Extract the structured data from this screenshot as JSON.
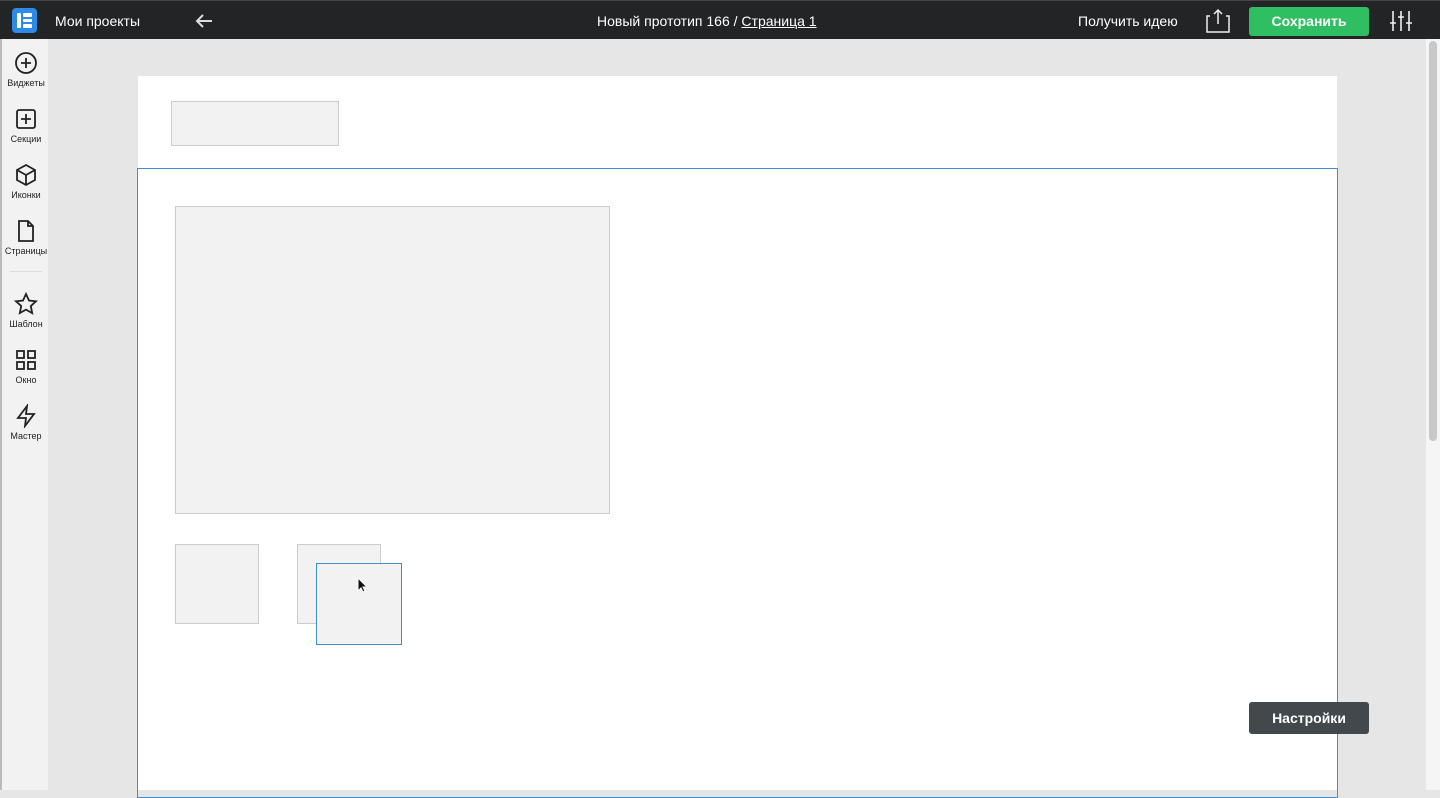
{
  "header": {
    "my_projects": "Мои проекты",
    "project_title": "Новый прототип 166 / ",
    "page_link": "Страница 1",
    "get_idea": "Получить идею",
    "save": "Сохранить"
  },
  "sidebar": {
    "items": [
      {
        "label": "Виджеты"
      },
      {
        "label": "Секции"
      },
      {
        "label": "Иконки"
      },
      {
        "label": "Страницы"
      },
      {
        "label": "Шаблон"
      },
      {
        "label": "Окно"
      },
      {
        "label": "Мастер"
      }
    ]
  },
  "canvas": {
    "settings": "Настройки"
  },
  "colors": {
    "accent": "#2fbf62",
    "selection": "#3d8fd6",
    "topbar": "#222426"
  }
}
